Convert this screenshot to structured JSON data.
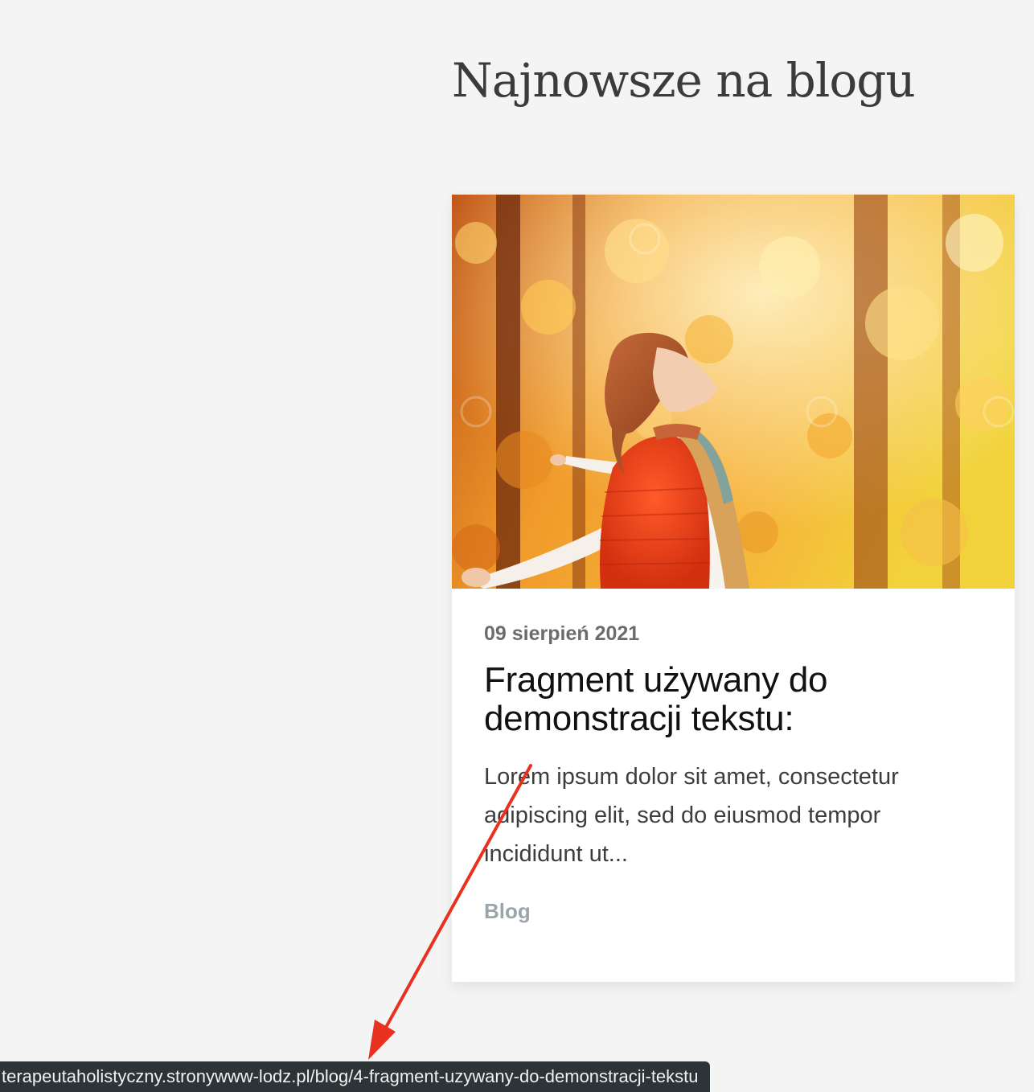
{
  "section": {
    "title": "Najnowsze na blogu"
  },
  "post": {
    "image_alt": "Kobieta w czerwonej kamizelce w jesiennym lesie",
    "date": "09 sierpień 2021",
    "title": "Fragment używany do demonstracji tekstu:",
    "excerpt": "Lorem ipsum dolor sit amet, consectetur adipiscing elit, sed do eiusmod tempor incididunt ut...",
    "category": "Blog"
  },
  "status_bar": {
    "url": "terapeutaholistyczny.stronywww-lodz.pl/blog/4-fragment-uzywany-do-demonstracji-tekstu"
  },
  "colors": {
    "page_bg": "#f4f4f4",
    "annotation_arrow": "#e8321f",
    "status_bar_bg": "#2c3437",
    "category_text": "#9aa6aa"
  }
}
